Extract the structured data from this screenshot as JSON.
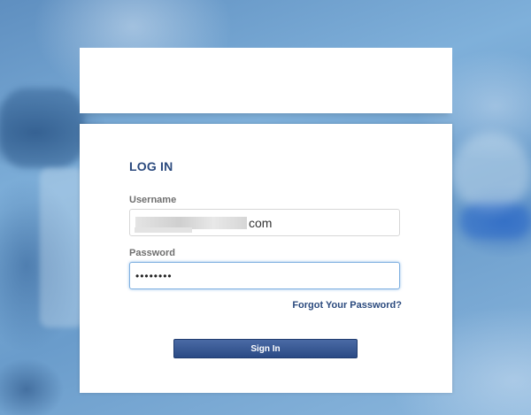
{
  "login": {
    "title": "LOG IN",
    "username_label": "Username",
    "username_value_visible": "com",
    "password_label": "Password",
    "password_masked": "••••••••",
    "forgot_link": "Forgot Your Password?",
    "sign_in_label": "Sign In"
  },
  "colors": {
    "accent": "#2b4a7e",
    "button": "#2f4f8a",
    "background": "#6e9fcb"
  }
}
